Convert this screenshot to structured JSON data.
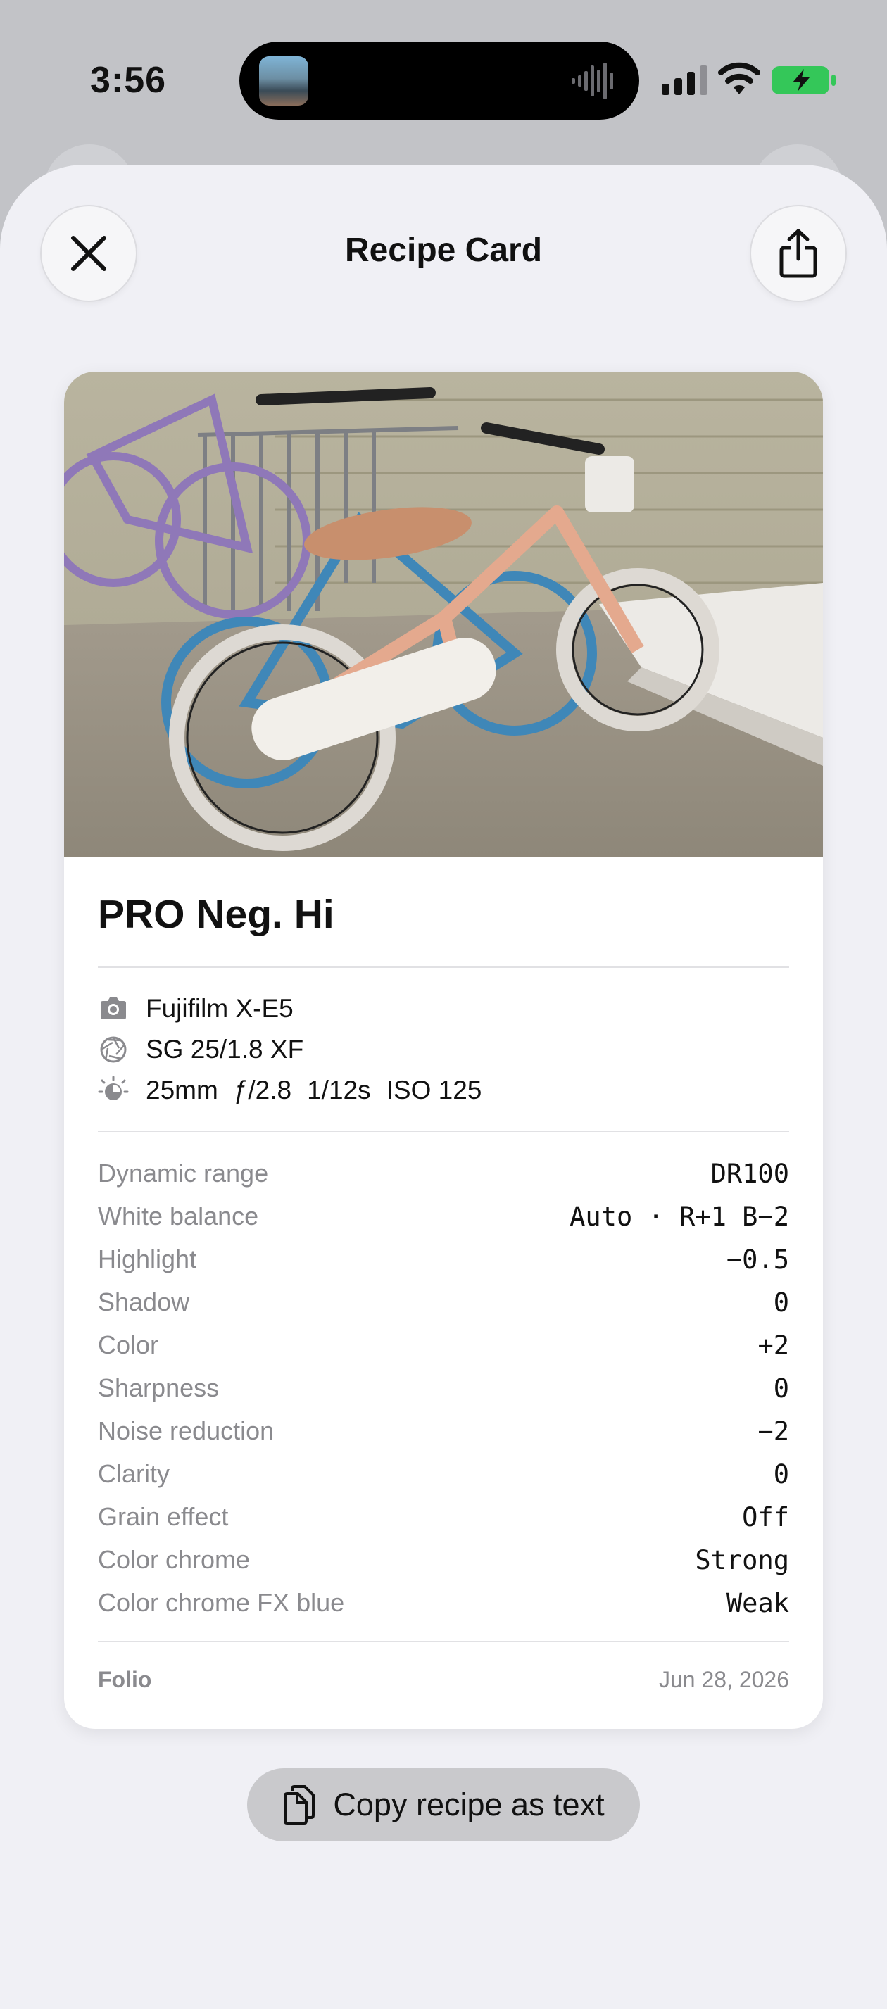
{
  "status_bar": {
    "time": "3:56"
  },
  "sheet": {
    "title": "Recipe Card"
  },
  "card": {
    "recipe_name": "PRO Neg. Hi",
    "camera": "Fujifilm X-E5",
    "lens": "SG 25/1.8 XF",
    "exposure": {
      "focal_length": "25mm",
      "aperture": "ƒ/2.8",
      "shutter": "1/12s",
      "iso": "ISO 125"
    },
    "settings": [
      {
        "label": "Dynamic range",
        "value": "DR100"
      },
      {
        "label": "White balance",
        "value": "Auto · R+1 B−2"
      },
      {
        "label": "Highlight",
        "value": "−0.5"
      },
      {
        "label": "Shadow",
        "value": "0"
      },
      {
        "label": "Color",
        "value": "+2"
      },
      {
        "label": "Sharpness",
        "value": "0"
      },
      {
        "label": "Noise reduction",
        "value": "−2"
      },
      {
        "label": "Clarity",
        "value": "0"
      },
      {
        "label": "Grain effect",
        "value": "Off"
      },
      {
        "label": "Color chrome",
        "value": "Strong"
      },
      {
        "label": "Color chrome FX blue",
        "value": "Weak"
      }
    ],
    "footer": {
      "brand": "Folio",
      "date": "Jun 28, 2026"
    }
  },
  "copy_button": {
    "label": "Copy recipe as text"
  },
  "colors": {
    "sheet_bg": "#f0f0f5",
    "card_bg": "#ffffff",
    "secondary_text": "#8a8a8e",
    "battery_green": "#34c759"
  },
  "icons": {
    "close": "close-icon",
    "share": "share-icon",
    "camera": "camera-icon",
    "lens": "aperture-icon",
    "exposure": "exposure-icon",
    "copy": "copy-icon"
  }
}
